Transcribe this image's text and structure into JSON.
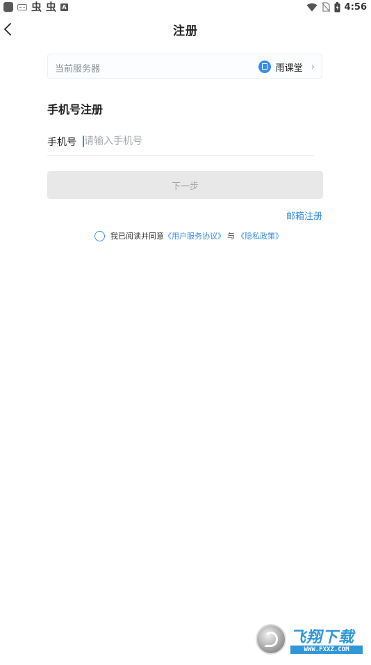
{
  "status_bar": {
    "time": "4:56",
    "left_icons": [
      "app-icon",
      "keyboard-icon",
      "bug-icon",
      "bug-icon",
      "a-icon"
    ],
    "right_icons": [
      "wifi-icon",
      "no-sim-icon",
      "battery-icon"
    ]
  },
  "header": {
    "title": "注册",
    "back_icon": "chevron-left-icon"
  },
  "server": {
    "label": "当前服务器",
    "value": "雨课堂",
    "arrow": "›"
  },
  "form": {
    "heading": "手机号注册",
    "phone_label": "手机号",
    "phone_placeholder": "请输入手机号",
    "phone_value": ""
  },
  "actions": {
    "next_label": "下一步",
    "email_register_label": "邮箱注册"
  },
  "agreement": {
    "prefix": "我已阅读并同意",
    "user_agreement": "《用户服务协议》",
    "join": "与",
    "privacy_policy": "《隐私政策》",
    "checked": false
  },
  "watermark": {
    "title": "飞翔下载",
    "url": "WWW.FXXZ.COM"
  },
  "colors": {
    "accent": "#3a8ee6",
    "button_disabled_bg": "#e8e8e8",
    "button_disabled_text": "#a6a6a6"
  }
}
